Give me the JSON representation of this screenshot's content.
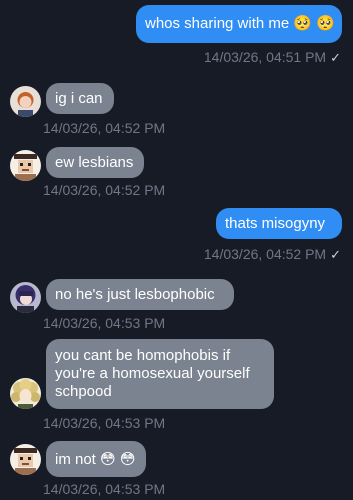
{
  "messages": [
    {
      "text": "whos sharing with me 🥺 🥺",
      "time": "14/03/26, 04:51 PM",
      "check": "✓"
    },
    {
      "text": "ig i can",
      "time": "14/03/26, 04:52 PM"
    },
    {
      "text": "ew lesbians",
      "time": "14/03/26, 04:52 PM"
    },
    {
      "text": "thats misogyny",
      "time": "14/03/26, 04:52 PM",
      "check": "✓"
    },
    {
      "text": "no he's just lesbophobic",
      "time": "14/03/26, 04:53 PM"
    },
    {
      "text": "you cant be homophobis if\nyou're a homosexual yourself\nschpood",
      "time": "14/03/26, 04:53 PM"
    },
    {
      "text": "im not 😳 😳",
      "time": "14/03/26, 04:53 PM"
    }
  ],
  "colors": {
    "background": "#161b26",
    "outgoing_bubble": "#2f8df3",
    "incoming_bubble": "#7b8290",
    "timestamp": "#6f7787"
  },
  "avatars": [
    "avatar-orange-hair",
    "avatar-pixel-face",
    "avatar-purple-hair",
    "avatar-curly-blonde",
    "avatar-pixel-face"
  ]
}
